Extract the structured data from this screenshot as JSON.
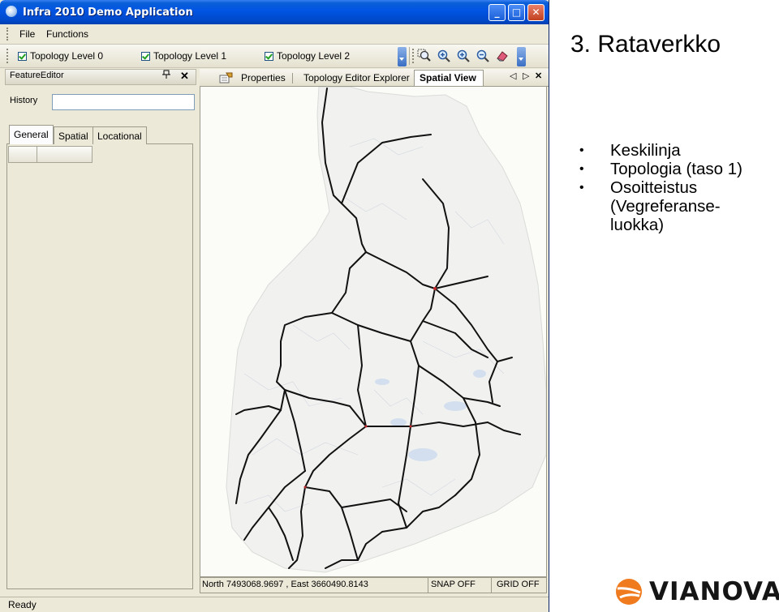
{
  "window": {
    "title": "Infra 2010 Demo Application",
    "minimize": "_",
    "maximize": "□",
    "close": "✕"
  },
  "menu": {
    "file": "File",
    "functions": "Functions"
  },
  "toolbar": {
    "levels": [
      "Topology Level 0",
      "Topology Level 1",
      "Topology Level 2"
    ],
    "tool_icons": [
      "zoom-box-icon",
      "zoom-in-icon",
      "zoom-in-alt-icon",
      "zoom-out-icon",
      "erase-icon"
    ]
  },
  "feature_editor": {
    "title": "FeatureEditor",
    "pin": "ᵖ",
    "close": "✕",
    "history_label": "History",
    "history_value": "",
    "tabs": [
      "General",
      "Spatial",
      "Locational"
    ]
  },
  "document": {
    "tabs": [
      "Properties",
      "Topology Editor Explorer",
      "Spatial View"
    ],
    "nav_left": "◁",
    "nav_right": "▷",
    "close": "✕"
  },
  "status": {
    "coordinates": "North 7493068.9697 , East 3660490.8143",
    "snap": "SNAP OFF",
    "grid": "GRID OFF",
    "app": "Ready"
  },
  "slide": {
    "title": "3. Rataverkko",
    "bullets": [
      "Keskilinja",
      "Topologia (taso 1)",
      "Osoitteistus\n(Vegreferanse-\nluokka)"
    ],
    "logo": "VIANOVA"
  },
  "colors": {
    "titlebar": "#0054e3",
    "railway": "#111111",
    "logo_orange": "#f07b1f",
    "check_green": "#21a121"
  }
}
